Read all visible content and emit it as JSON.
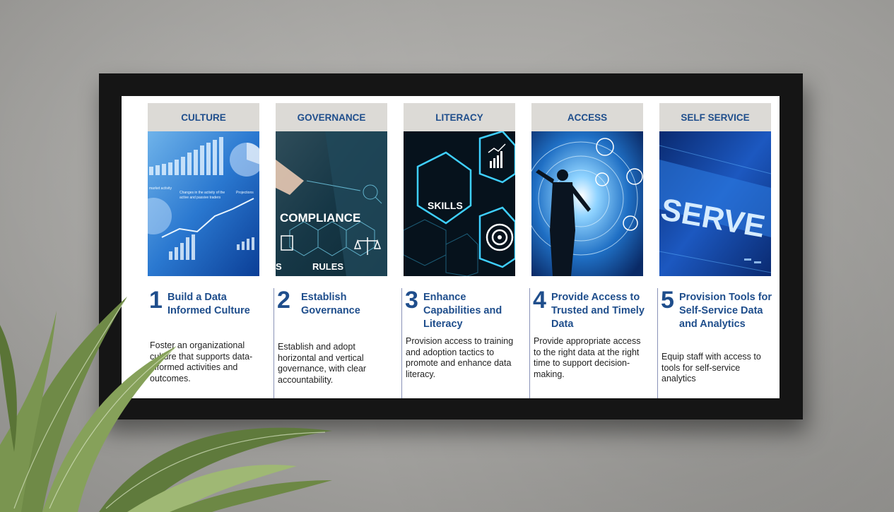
{
  "columns": [
    {
      "header": "CULTURE",
      "number": "1",
      "title": "Build a Data Informed Culture",
      "description": "Foster an organizational culture that supports data-informed activities and outcomes.",
      "image_text": [
        "Changes in the activity of the",
        "active and passive traders",
        "Projections",
        "market activity"
      ]
    },
    {
      "header": "GOVERNANCE",
      "number": "2",
      "title": "Establish Governance",
      "description": "Establish and adopt horizontal and vertical governance, with clear accountability.",
      "image_text": [
        "COMPLIANCE",
        "RULES",
        "S"
      ]
    },
    {
      "header": "LITERACY",
      "number": "3",
      "title": "Enhance Capabilities and Literacy",
      "description": "Provision access to training and adoption tactics to promote and enhance data literacy.",
      "image_text": [
        "SKILLS"
      ]
    },
    {
      "header": "ACCESS",
      "number": "4",
      "title": "Provide Access to Trusted and Timely Data",
      "description": "Provide appropriate access to the right data at the right time to support decision-making.",
      "image_text": []
    },
    {
      "header": "SELF SERVICE",
      "number": "5",
      "title": "Provision Tools for Self-Service Data and Analytics",
      "description": "Equip staff with access to tools for self-service analytics",
      "image_text": [
        "SERVE"
      ]
    }
  ],
  "colors": {
    "accent_blue": "#1f4e8c",
    "header_bg": "#dcdad6",
    "frame": "#151515",
    "wall": "#a7a6a3"
  }
}
